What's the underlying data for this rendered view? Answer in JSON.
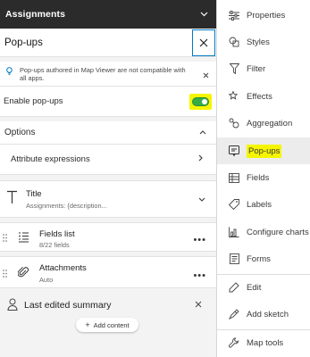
{
  "layer": {
    "name": "Assignments"
  },
  "panel": {
    "title": "Pop-ups",
    "notice": "Pop-ups authored in Map Viewer are not compatible with all apps.",
    "enable_label": "Enable pop-ups",
    "enable_on": true,
    "options_label": "Options",
    "attribute_expressions_label": "Attribute expressions",
    "title_card": {
      "title": "Title",
      "subtitle": "Assignments: {description..."
    },
    "fields_card": {
      "title": "Fields list",
      "subtitle": "8/22 fields"
    },
    "attachments_card": {
      "title": "Attachments",
      "subtitle": "Auto"
    },
    "summary_label": "Last edited summary",
    "add_content_label": "Add content"
  },
  "rail": {
    "items": [
      {
        "label": "Properties",
        "icon": "sliders-icon"
      },
      {
        "label": "Styles",
        "icon": "styles-icon"
      },
      {
        "label": "Filter",
        "icon": "filter-icon"
      },
      {
        "label": "Effects",
        "icon": "effects-icon"
      },
      {
        "label": "Aggregation",
        "icon": "aggregation-icon"
      },
      {
        "label": "Pop-ups",
        "icon": "popup-icon",
        "active": true
      },
      {
        "label": "Fields",
        "icon": "fields-icon"
      },
      {
        "label": "Labels",
        "icon": "labels-icon"
      },
      {
        "label": "Configure charts",
        "icon": "charts-icon"
      },
      {
        "label": "Forms",
        "icon": "forms-icon"
      },
      {
        "label": "Edit",
        "icon": "edit-icon"
      },
      {
        "label": "Add sketch",
        "icon": "sketch-icon"
      },
      {
        "label": "Map tools",
        "icon": "map-tools-icon"
      }
    ]
  },
  "colors": {
    "accent": "#007ac2",
    "toggle_on": "#35ac46",
    "highlight": "#f5f500",
    "layer_bar": "#2b2b2b"
  }
}
